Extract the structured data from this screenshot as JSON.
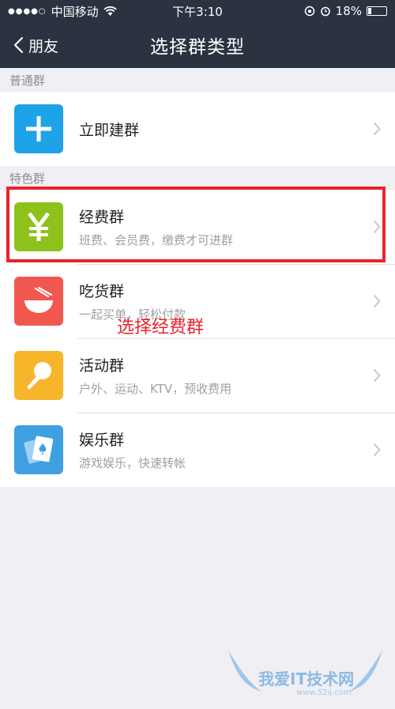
{
  "status_bar": {
    "signal": "●●●●○",
    "carrier": "中国移动",
    "time": "下午3:10",
    "battery_text": "18%",
    "battery_level": 0.18
  },
  "nav": {
    "back_label": "朋友",
    "title": "选择群类型"
  },
  "sections": {
    "normal_header": "普通群",
    "special_header": "特色群"
  },
  "items": {
    "create": {
      "title": "立即建群",
      "icon": "plus-icon",
      "color": "#1ea2e8"
    },
    "expense": {
      "title": "经费群",
      "subtitle": "班费、会员费，缴费才可进群",
      "icon": "yen-icon",
      "color": "#8dc11b"
    },
    "foodie": {
      "title": "吃货群",
      "subtitle": "一起买单，轻松付款",
      "icon": "bowl-icon",
      "color": "#f0584f"
    },
    "activity": {
      "title": "活动群",
      "subtitle": "户外、运动、KTV，预收费用",
      "icon": "microphone-icon",
      "color": "#f7b52b"
    },
    "fun": {
      "title": "娱乐群",
      "subtitle": "游戏娱乐，快速转帐",
      "icon": "playing-card-icon",
      "color": "#3f9fe3"
    }
  },
  "annotation": "选择经费群",
  "watermark": {
    "text": "我爱IT技术网",
    "url": "www.52ij.com"
  }
}
